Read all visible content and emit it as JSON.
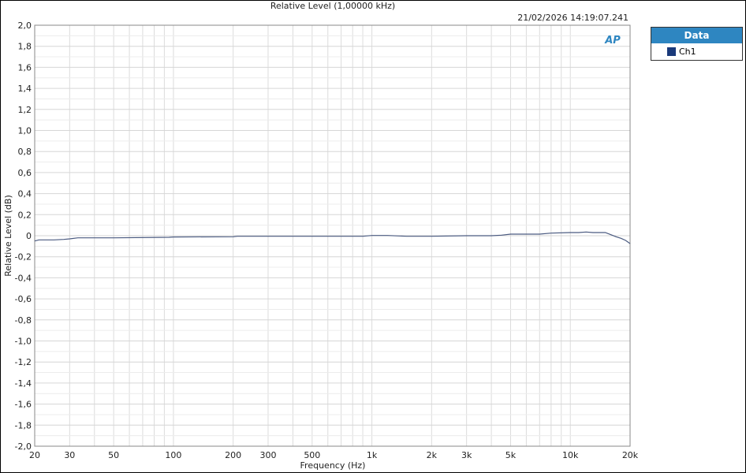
{
  "chart_data": {
    "type": "line",
    "title": "Relative Level (1,00000 kHz)",
    "timestamp": "21/02/2026 14:19:07.241",
    "xlabel": "Frequency (Hz)",
    "ylabel": "Relative Level (dB)",
    "xscale": "log",
    "xlim": [
      20,
      20000
    ],
    "ylim": [
      -2,
      2
    ],
    "grid": true,
    "xticks": [
      20,
      30,
      50,
      100,
      200,
      300,
      500,
      1000,
      2000,
      3000,
      5000,
      10000,
      20000
    ],
    "xtick_labels": [
      "20",
      "30",
      "50",
      "100",
      "200",
      "300",
      "500",
      "1k",
      "2k",
      "3k",
      "5k",
      "10k",
      "20k"
    ],
    "yticks": [
      2,
      1.8,
      1.6,
      1.4,
      1.2,
      1,
      0.8,
      0.6,
      0.4,
      0.2,
      0,
      -0.2,
      -0.4,
      -0.6,
      -0.8,
      -1,
      -1.2,
      -1.4,
      -1.6,
      -1.8,
      -2
    ],
    "ytick_labels": [
      "2,0",
      "1,8",
      "1,6",
      "1,4",
      "1,2",
      "1,0",
      "0,8",
      "0,6",
      "0,4",
      "0,2",
      "0",
      "-0,2",
      "-0,4",
      "-0,6",
      "-0,8",
      "-1,0",
      "-1,2",
      "-1,4",
      "-1,6",
      "-1,8",
      "-2,0"
    ],
    "legend": {
      "title": "Data",
      "position": "right"
    },
    "series": [
      {
        "name": "Ch1",
        "color": "#1a3a7a",
        "x": [
          20,
          21,
          22,
          25,
          28,
          30,
          33,
          36,
          50,
          95,
          100,
          200,
          210,
          500,
          900,
          1000,
          1200,
          1500,
          2000,
          3000,
          4000,
          4500,
          5000,
          7000,
          8000,
          10000,
          11000,
          12000,
          13000,
          15000,
          16000,
          17000,
          18000,
          19000,
          20000
        ],
        "y": [
          -0.05,
          -0.04,
          -0.04,
          -0.04,
          -0.035,
          -0.03,
          -0.02,
          -0.02,
          -0.02,
          -0.015,
          -0.012,
          -0.01,
          -0.005,
          -0.005,
          -0.005,
          0.002,
          0.002,
          -0.005,
          -0.005,
          0,
          0,
          0.005,
          0.015,
          0.015,
          0.025,
          0.03,
          0.03,
          0.035,
          0.03,
          0.03,
          0.01,
          -0.01,
          -0.025,
          -0.045,
          -0.075
        ]
      }
    ]
  },
  "logo": "AP"
}
